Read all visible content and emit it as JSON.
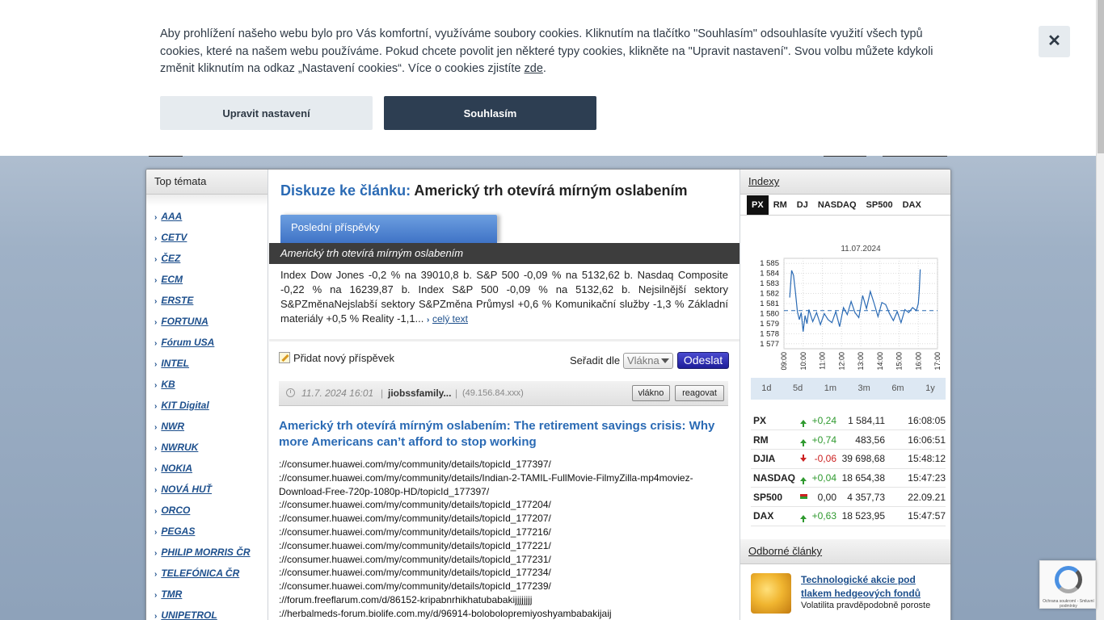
{
  "cookie": {
    "text_before": "Aby prohlížení našeho webu bylo pro Vás komfortní, využíváme soubory cookies. Kliknutím na tlačítko \"Souhlasím\" odsouhlasíte využití všech typů cookies, které na našem webu používáme. Pokud chcete povolit jen některé typy cookies, klikněte na \"Upravit nastavení\". Svou volbu můžete kdykoli změnit kliknutím na odkaz „Nastavení cookies“. Více o cookies zjistíte ",
    "link": "zde",
    "text_after": ".",
    "settings_label": "Upravit nastavení",
    "accept_label": "Souhlasím",
    "close_label": "✕"
  },
  "left": {
    "title": "Top témata",
    "topics": [
      "AAA",
      "CETV",
      "ČEZ",
      "ECM",
      "ERSTE",
      "FORTUNA",
      "Fórum USA",
      "INTEL",
      "KB",
      "KIT Digital",
      "NWR",
      "NWRUK",
      "NOKIA",
      "NOVÁ HUŤ",
      "ORCO",
      "PEGAS",
      "PHILIP MORRIS ČR",
      "TELEFÓNICA ČR",
      "TMR",
      "UNIPETROL"
    ]
  },
  "center": {
    "title_lead": "Diskuze ke článku:",
    "title_main": "Americký trh otevírá mírným oslabením",
    "tab_label": "Poslední příspěvky",
    "article_bar": "Americký trh otevírá mírným oslabením",
    "excerpt": "Index Dow Jones -0,2 % na 39010,8 b. S&P 500 -0,09 % na 5132,62 b. Nasdaq Composite -0,22 % na 16239,87 b. Index S&P 500 -0,09 % na 5132,62 b. Nejsilnější sektory S&PZměnaNejslabší sektory S&PZměna Průmysl +0,6 % Komunikační služby -1,3 % Základní materiály +0,5 % Reality -1,1...",
    "full_text_label": "celý text",
    "add_post_label": "Přidat nový příspěvek",
    "sort_label": "Seřadit dle",
    "sort_value": "Vlákna",
    "send_label": "Odeslat",
    "post": {
      "date": "11.7. 2024 16:01",
      "sep": "|",
      "user": "jiobssfamily...",
      "ip": "(49.156.84.xxx)",
      "thread_label": "vlákno",
      "reply_label": "reagovat",
      "title": "Americký trh otevírá mírným oslabením:  The retirement savings crisis: Why more Americans can’t afford to stop working",
      "lines": [
        "://consumer.huawei.com/my/community/details/topicId_177397/",
        "://consumer.huawei.com/my/community/details/Indian-2-TAMIL-FullMovie-FilmyZilla-mp4moviez-",
        "Download-Free-720p-1080p-HD/topicId_177397/",
        "://consumer.huawei.com/my/community/details/topicId_177204/",
        "://consumer.huawei.com/my/community/details/topicId_177207/",
        "://consumer.huawei.com/my/community/details/topicId_177216/",
        "://consumer.huawei.com/my/community/details/topicId_177221/",
        "://consumer.huawei.com/my/community/details/topicId_177231/",
        "://consumer.huawei.com/my/community/details/topicId_177234/",
        "://consumer.huawei.com/my/community/details/topicId_177239/",
        "://forum.freeflarum.com/d/86152-kripabnrhikhatubabakijjjjjjjj",
        "://herbalmeds-forum.biolife.com.my/d/96914-bolobolopremiyoshyambabakijaij"
      ]
    }
  },
  "right": {
    "title": "Indexy",
    "tabs": [
      "PX",
      "RM",
      "DJ",
      "NASDAQ",
      "SP500",
      "DAX"
    ],
    "active_tab": "PX",
    "ranges": [
      "1d",
      "5d",
      "1m",
      "3m",
      "6m",
      "1y"
    ],
    "indices": [
      {
        "name": "PX",
        "dir": "up",
        "change": "+0,24",
        "value": "1 584,11",
        "time": "16:08:05"
      },
      {
        "name": "RM",
        "dir": "up",
        "change": "+0,74",
        "value": "483,56",
        "time": "16:06:51"
      },
      {
        "name": "DJIA",
        "dir": "down",
        "change": "-0,06",
        "value": "39 698,68",
        "time": "15:48:12"
      },
      {
        "name": "NASDAQ",
        "dir": "up",
        "change": "+0,04",
        "value": "18 654,38",
        "time": "15:47:23"
      },
      {
        "name": "SP500",
        "dir": "flat",
        "change": "0,00",
        "value": "4 357,73",
        "time": "22.09.21"
      },
      {
        "name": "DAX",
        "dir": "up",
        "change": "+0,63",
        "value": "18 523,95",
        "time": "15:47:57"
      }
    ],
    "articles_title": "Odborné články",
    "article_title": "Technologické akcie pod tlakem hedgeových fondů",
    "article_sub": "Volatilita pravděpodobně poroste"
  },
  "recaptcha": {
    "text": "Ochrana soukromí - Smluvní podmínky"
  },
  "colors": {
    "accent": "#2a6ab4",
    "cookie_dark": "#2d3e52",
    "up": "#2f9a2f",
    "down": "#cc2222"
  },
  "chart_data": {
    "type": "line",
    "title": "11.07.2024",
    "categories": [
      "09:00",
      "10:00",
      "11:00",
      "12:00",
      "13:00",
      "14:00",
      "15:00",
      "16:00",
      "17:00"
    ],
    "ylim": [
      1576.5,
      1585.5
    ],
    "yticks": [
      "1 585",
      "1 584",
      "1 583",
      "1 582",
      "1 581",
      "1 580",
      "1 579",
      "1 578",
      "1 577"
    ],
    "reference": 1580.3,
    "x": [
      9.3,
      9.4,
      9.5,
      9.6,
      9.7,
      9.8,
      9.9,
      10.0,
      10.1,
      10.2,
      10.3,
      10.5,
      10.7,
      10.9,
      11.1,
      11.3,
      11.5,
      11.7,
      11.9,
      12.1,
      12.3,
      12.5,
      12.7,
      12.9,
      13.1,
      13.3,
      13.5,
      13.7,
      13.9,
      14.1,
      14.3,
      14.5,
      14.7,
      14.9,
      15.1,
      15.3,
      15.5,
      15.7,
      15.9,
      16.0,
      16.05,
      16.1
    ],
    "values": [
      1581.6,
      1584.3,
      1583.8,
      1582.1,
      1580.2,
      1579.4,
      1580.1,
      1578.2,
      1579.8,
      1579.0,
      1580.4,
      1579.2,
      1580.1,
      1578.9,
      1580.0,
      1579.4,
      1579.1,
      1580.2,
      1578.7,
      1580.6,
      1579.9,
      1581.2,
      1580.1,
      1579.6,
      1581.8,
      1580.5,
      1582.2,
      1581.0,
      1579.7,
      1581.1,
      1580.9,
      1580.0,
      1579.3,
      1580.2,
      1579.1,
      1580.4,
      1580.1,
      1580.6,
      1580.3,
      1581.0,
      1582.3,
      1584.4
    ]
  }
}
